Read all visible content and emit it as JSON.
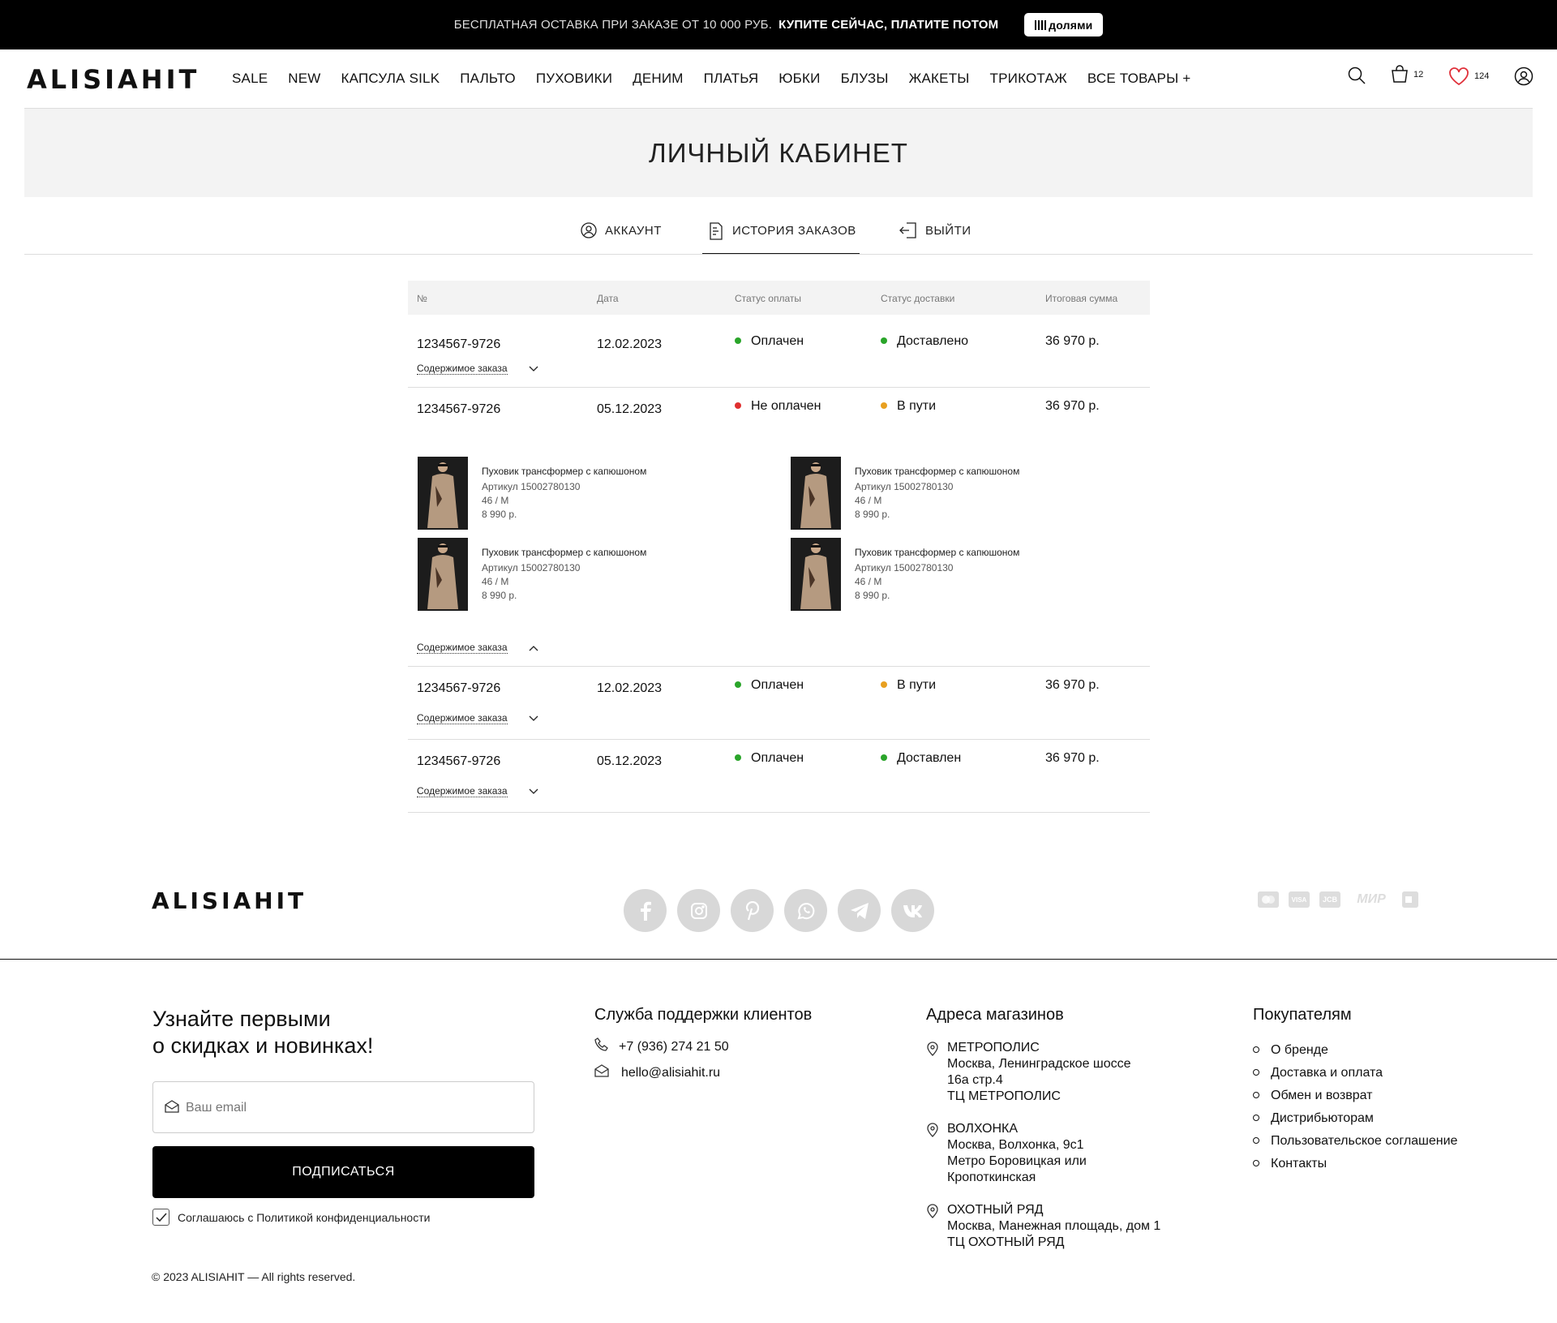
{
  "promo": {
    "text1": "БЕСПЛАТНАЯ ОСТАВКА ПРИ ЗАКАЗЕ ОТ 10 000 РУБ.",
    "text2": "КУПИТЕ СЕЙЧАС, ПЛАТИТЕ ПОТОМ",
    "badge": "долями"
  },
  "header": {
    "logo": "ALISIAHIT",
    "nav": [
      "SALE",
      "NEW",
      "КАПСУЛА SILK",
      "ПАЛЬТО",
      "ПУХОВИКИ",
      "ДЕНИМ",
      "ПЛАТЬЯ",
      "ЮБКИ",
      "БЛУЗЫ",
      "ЖАКЕТЫ",
      "ТРИКОТАЖ",
      "ВСЕ ТОВАРЫ +"
    ],
    "cart_count": "12",
    "favorites_count": "124"
  },
  "page": {
    "title": "ЛИЧНЫЙ КАБИНЕТ"
  },
  "tabs": {
    "account": "АККАУНТ",
    "history": "ИСТОРИЯ ЗАКАЗОВ",
    "logout": "ВЫЙТИ"
  },
  "orders": {
    "headers": [
      "№",
      "Дата",
      "Статус оплаты",
      "Статус доставки",
      "Итоговая сумма"
    ],
    "toggle_label": "Содержимое заказа",
    "rows": [
      {
        "number": "1234567-9726",
        "date": "12.02.2023",
        "payment": "Оплачен",
        "delivery": "Доставлено",
        "total": "36 970 р."
      },
      {
        "number": "1234567-9726",
        "date": "05.12.2023",
        "payment": "Не оплачен",
        "delivery": "В пути",
        "total": "36 970 р."
      },
      {
        "number": "1234567-9726",
        "date": "12.02.2023",
        "payment": "Оплачен",
        "delivery": "В пути",
        "total": "36 970 р."
      },
      {
        "number": "1234567-9726",
        "date": "05.12.2023",
        "payment": "Оплачен",
        "delivery": "Доставлен",
        "total": "36 970 р."
      }
    ],
    "items": [
      {
        "name": "Пуховик трансформер с капюшоном",
        "sku": "Артикул 15002780130",
        "size": "46 / M",
        "price": "8 990 р."
      },
      {
        "name": "Пуховик трансформер с капюшоном",
        "sku": "Артикул 15002780130",
        "size": "46 / M",
        "price": "8 990 р."
      },
      {
        "name": "Пуховик трансформер с капюшоном",
        "sku": "Артикул 15002780130",
        "size": "46 / M",
        "price": "8 990 р."
      },
      {
        "name": "Пуховик трансформер с капюшоном",
        "sku": "Артикул 15002780130",
        "size": "46 / M",
        "price": "8 990 р."
      }
    ],
    "colors": {
      "paid": "#2aa52a",
      "unpaid": "#e03030",
      "transit": "#e8a020",
      "delivered": "#2aa52a"
    }
  },
  "footer": {
    "logo": "ALISIAHIT",
    "pay_labels": [
      "VISA",
      "JCB",
      "МИР"
    ],
    "subscribe": {
      "title_line1": "Узнайте первыми",
      "title_line2": "о скидках и новинках!",
      "email_placeholder": "Ваш email",
      "button": "ПОДПИСАТЬСЯ",
      "agree": "Соглашаюсь с Политикой конфиденциальности"
    },
    "support": {
      "title": "Служба поддержки клиентов",
      "phone": "+7 (936) 274 21 50",
      "email": "hello@alisiahit.ru"
    },
    "stores": {
      "title": "Адреса магазинов",
      "list": [
        {
          "name": "МЕТРОПОЛИС",
          "l1": "Москва, Ленинградское шоссе",
          "l2": "16а стр.4",
          "l3": "ТЦ МЕТРОПОЛИС"
        },
        {
          "name": "ВОЛХОНКА",
          "l1": "Москва, Волхонка, 9с1",
          "l2": "Метро Боровицкая или",
          "l3": "Кропоткинская"
        },
        {
          "name": "ОХОТНЫЙ РЯД",
          "l1": "Москва, Манежная площадь, дом 1",
          "l2": "ТЦ ОХОТНЫЙ РЯД"
        }
      ]
    },
    "buyers": {
      "title": "Покупателям",
      "links": [
        "О бренде",
        "Доставка и оплата",
        "Обмен и возврат",
        "Дистрибьюторам",
        "Пользовательское соглашение",
        "Контакты"
      ]
    },
    "copyright": "© 2023 ALISIAHIT — All rights reserved."
  }
}
